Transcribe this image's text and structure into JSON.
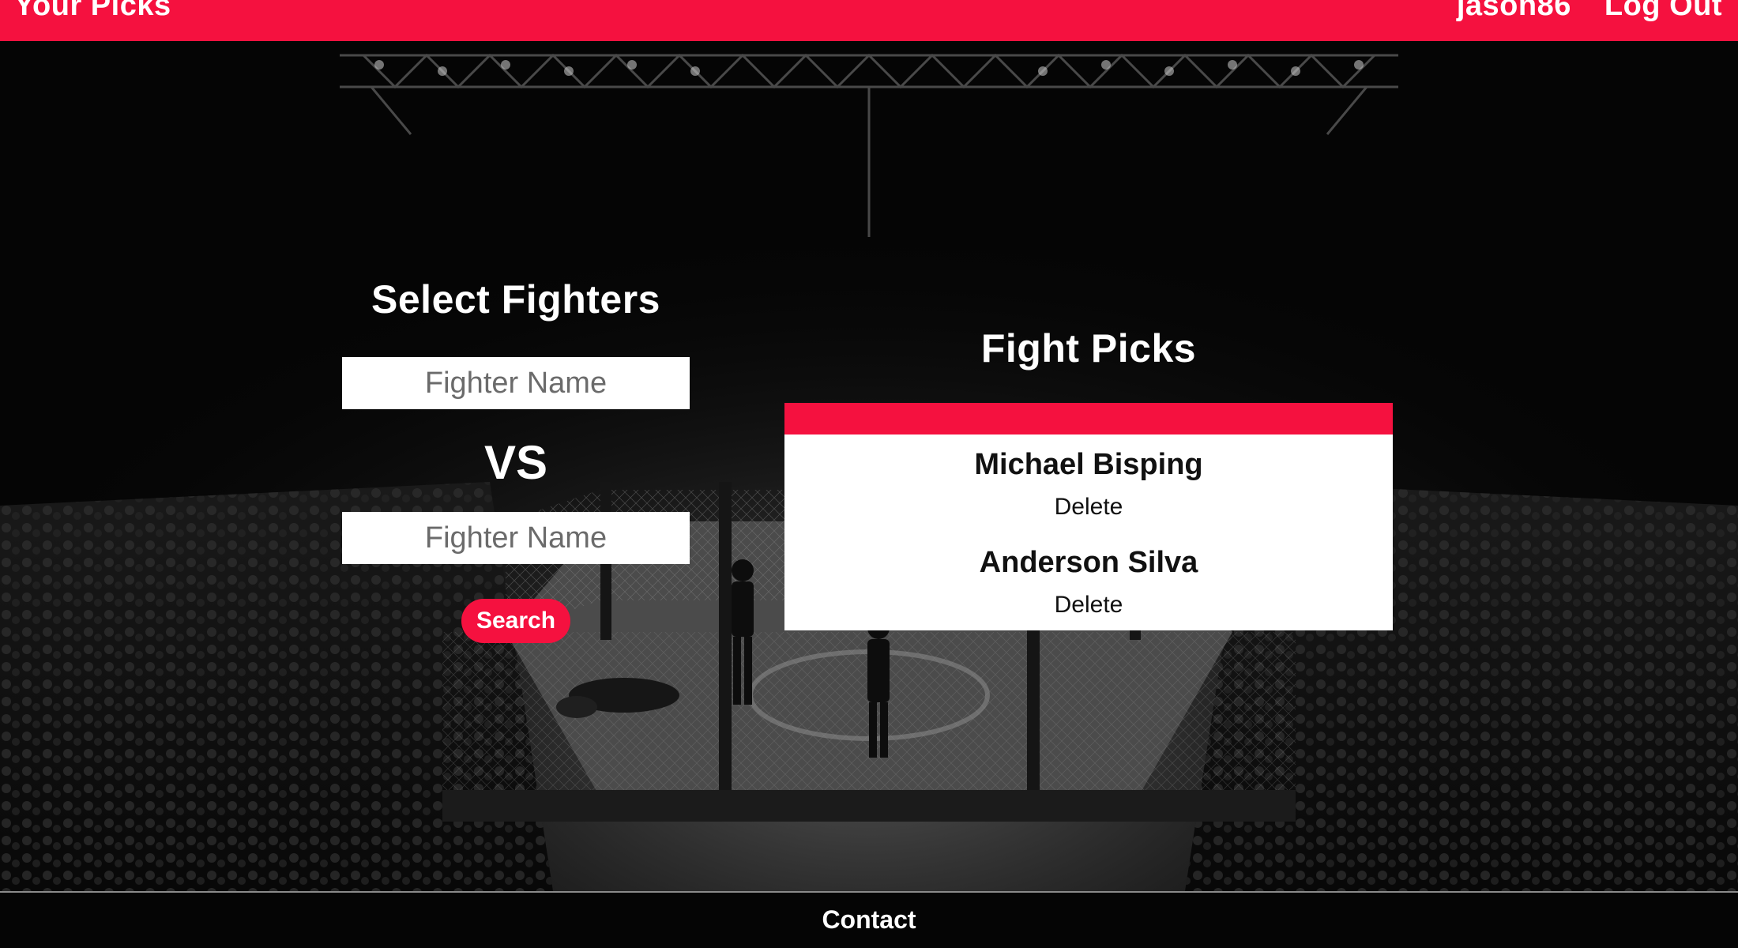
{
  "nav": {
    "brand": "Your Picks",
    "username": "jason86",
    "logout": "Log Out"
  },
  "select": {
    "title": "Select Fighters",
    "fighter1_placeholder": "Fighter Name",
    "vs": "VS",
    "fighter2_placeholder": "Fighter Name",
    "search": "Search"
  },
  "picks": {
    "title": "Fight Picks",
    "items": [
      {
        "name": "Michael Bisping",
        "delete": "Delete"
      },
      {
        "name": "Anderson Silva",
        "delete": "Delete"
      }
    ]
  },
  "footer": {
    "contact": "Contact"
  },
  "colors": {
    "accent": "#f5113f",
    "background": "#050505",
    "card": "#ffffff"
  }
}
